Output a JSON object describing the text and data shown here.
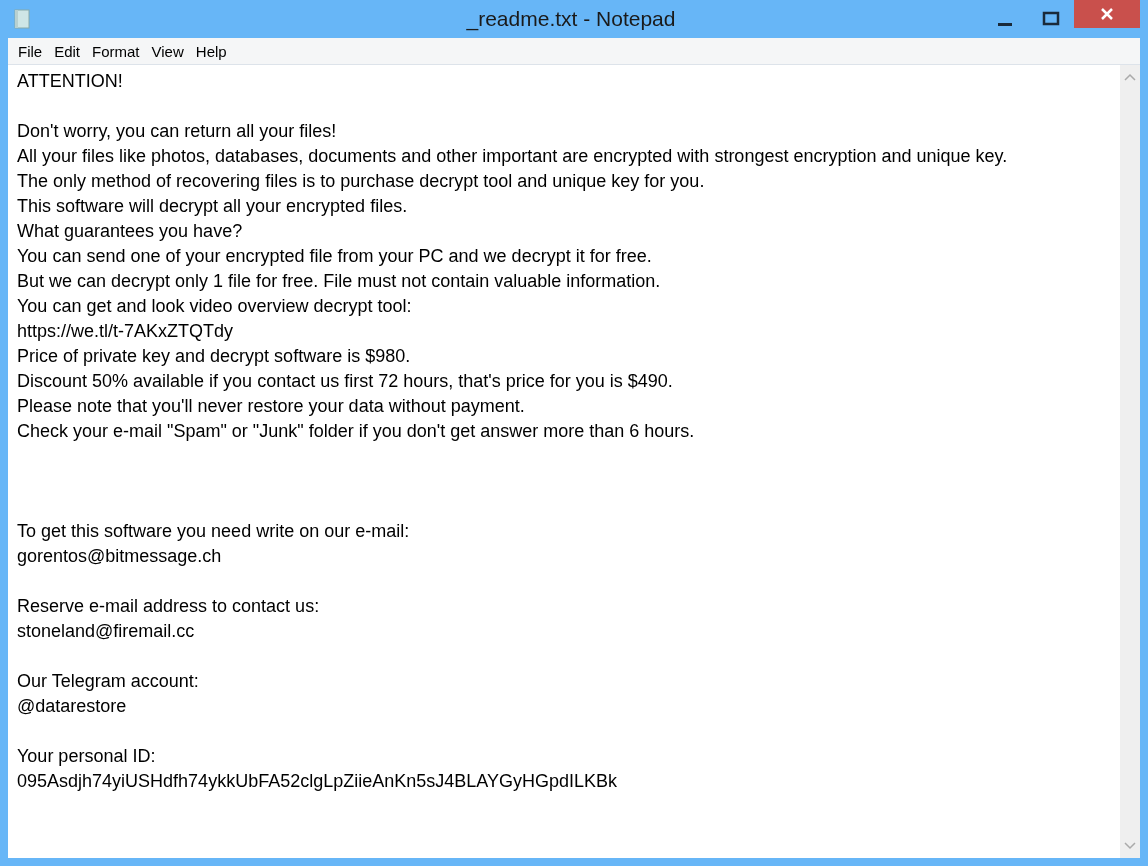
{
  "window": {
    "title": "_readme.txt - Notepad"
  },
  "menu": [
    "File",
    "Edit",
    "Format",
    "View",
    "Help"
  ],
  "document": [
    {
      "kind": "first",
      "lines": [
        "ATTENTION!"
      ]
    },
    {
      "kind": "break",
      "lines": [
        "Don't worry, you can return all your files!",
        "All your files like photos, databases, documents and other important are encrypted with strongest encryption and unique key.",
        "The only method of recovering files is to purchase decrypt tool and unique key for you.",
        "This software will decrypt all your encrypted files.",
        "What guarantees you have?",
        "You can send one of your encrypted file from your PC and we decrypt it for free.",
        "But we can decrypt only 1 file for free. File must not contain valuable information.",
        "You can get and look video overview decrypt tool:",
        "https://we.tl/t-7AKxZTQTdy",
        "Price of private key and decrypt software is $980.",
        "Discount 50% available if you contact us first 72 hours, that's price for you is $490.",
        "Please note that you'll never restore your data without payment.",
        "Check your e-mail \"Spam\" or \"Junk\" folder if you don't get answer more than 6 hours."
      ]
    },
    {
      "kind": "wide_break",
      "lines": [
        "To get this software you need write on our e-mail:",
        "gorentos@bitmessage.ch"
      ]
    },
    {
      "kind": "break",
      "lines": [
        "Reserve e-mail address to contact us:",
        "stoneland@firemail.cc"
      ]
    },
    {
      "kind": "break",
      "lines": [
        "Our Telegram account:",
        "@datarestore"
      ]
    },
    {
      "kind": "break",
      "lines": [
        "Your personal ID:",
        "095Asdjh74yiUSHdfh74ykkUbFA52clgLpZiieAnKn5sJ4BLAYGyHGpdILKBk"
      ]
    }
  ]
}
